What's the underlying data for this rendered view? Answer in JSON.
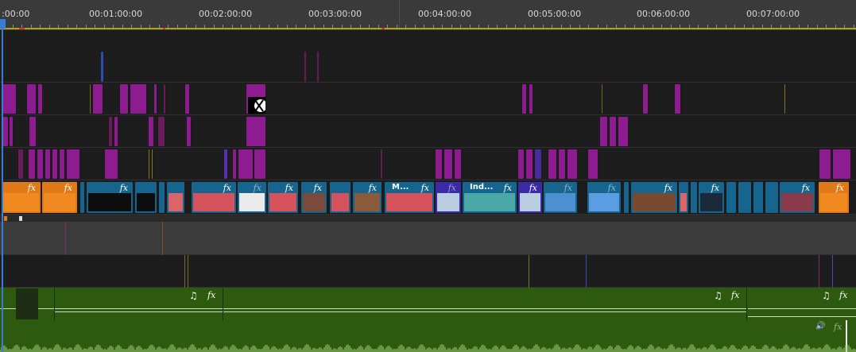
{
  "ruler": {
    "timecodes": [
      ":00:00",
      "00:01:00:00",
      "00:02:00:00",
      "00:03:00:00",
      "00:04:00:00",
      "00:05:00:00",
      "00:06:00:00",
      "00:07:00:00"
    ]
  },
  "video_track": {
    "clip_labels": [
      "M...",
      "Ind..."
    ],
    "fx_glyph": "fx"
  },
  "audio_track": {
    "music_glyph": "♫",
    "fx_glyph": "fx",
    "voice_glyph": "🔊"
  },
  "colors": {
    "overlay_clip": "#8c1c8f",
    "video_clip": "#16658f",
    "audio_clip": "#2e5a10",
    "playhead": "#3a7bd5",
    "ruler_bg": "#3a3a3a"
  },
  "icons": [
    "music-note-icon",
    "fx-icon",
    "speaker-icon",
    "transition-icon"
  ]
}
